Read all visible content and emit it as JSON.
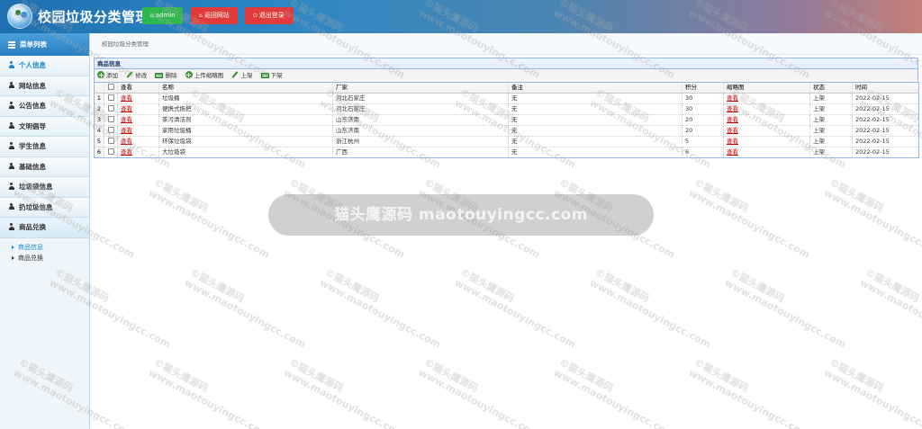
{
  "header": {
    "title": "校园垃圾分类管理",
    "buttons": {
      "admin": "admin",
      "back": "返回网站",
      "logout": "退出登录"
    }
  },
  "sidebar": {
    "title": "菜单列表",
    "items": [
      {
        "label": "个人信息"
      },
      {
        "label": "网站信息"
      },
      {
        "label": "公告信息"
      },
      {
        "label": "文明倡导"
      },
      {
        "label": "学生信息"
      },
      {
        "label": "基础信息"
      },
      {
        "label": "垃圾袋信息"
      },
      {
        "label": "扔垃圾信息"
      },
      {
        "label": "商品兑换"
      }
    ],
    "sub_items": [
      {
        "label": "商品信息"
      },
      {
        "label": "商品兑换"
      }
    ]
  },
  "breadcrumb": "校园垃圾分类管理",
  "panel": {
    "title": "商品信息"
  },
  "toolbar": {
    "add": "添加",
    "edit": "修改",
    "delete": "删除",
    "upload_thumb": "上传缩略图",
    "on_shelf": "上架",
    "off_shelf": "下架"
  },
  "table": {
    "columns": {
      "view": "查看",
      "name": "名称",
      "vendor": "厂家",
      "remark": "备注",
      "points": "积分",
      "thumbnail": "缩略图",
      "status": "状态",
      "time": "时间"
    },
    "rows": [
      {
        "no": "1",
        "view": "查看",
        "name": "垃圾桶",
        "vendor": "河北石家庄",
        "remark": "无",
        "points": "30",
        "thumbnail": "查看",
        "status": "上架",
        "time": "2022-02-15"
      },
      {
        "no": "2",
        "view": "查看",
        "name": "便携式拖把",
        "vendor": "河北石家庄",
        "remark": "无",
        "points": "30",
        "thumbnail": "查看",
        "status": "上架",
        "time": "2022-02-15"
      },
      {
        "no": "3",
        "view": "查看",
        "name": "茶污清洁剂",
        "vendor": "山东济南",
        "remark": "无",
        "points": "20",
        "thumbnail": "查看",
        "status": "上架",
        "time": "2022-02-15"
      },
      {
        "no": "4",
        "view": "查看",
        "name": "家用垃圾桶",
        "vendor": "山东济南",
        "remark": "无",
        "points": "20",
        "thumbnail": "查看",
        "status": "上架",
        "time": "2022-02-15"
      },
      {
        "no": "5",
        "view": "查看",
        "name": "环保垃圾袋",
        "vendor": "浙江杭州",
        "remark": "无",
        "points": "5",
        "thumbnail": "查看",
        "status": "上架",
        "time": "2022-02-15"
      },
      {
        "no": "6",
        "view": "查看",
        "name": "大垃圾袋",
        "vendor": "广西",
        "remark": "无",
        "points": "6",
        "thumbnail": "查看",
        "status": "上架",
        "time": "2022-02-15"
      }
    ]
  },
  "watermark": {
    "text_cn": "©猫头鹰源码",
    "text_url": "www.maotouyingcc.com",
    "overlay": "猫头鹰源码 maotouyingcc.com"
  }
}
